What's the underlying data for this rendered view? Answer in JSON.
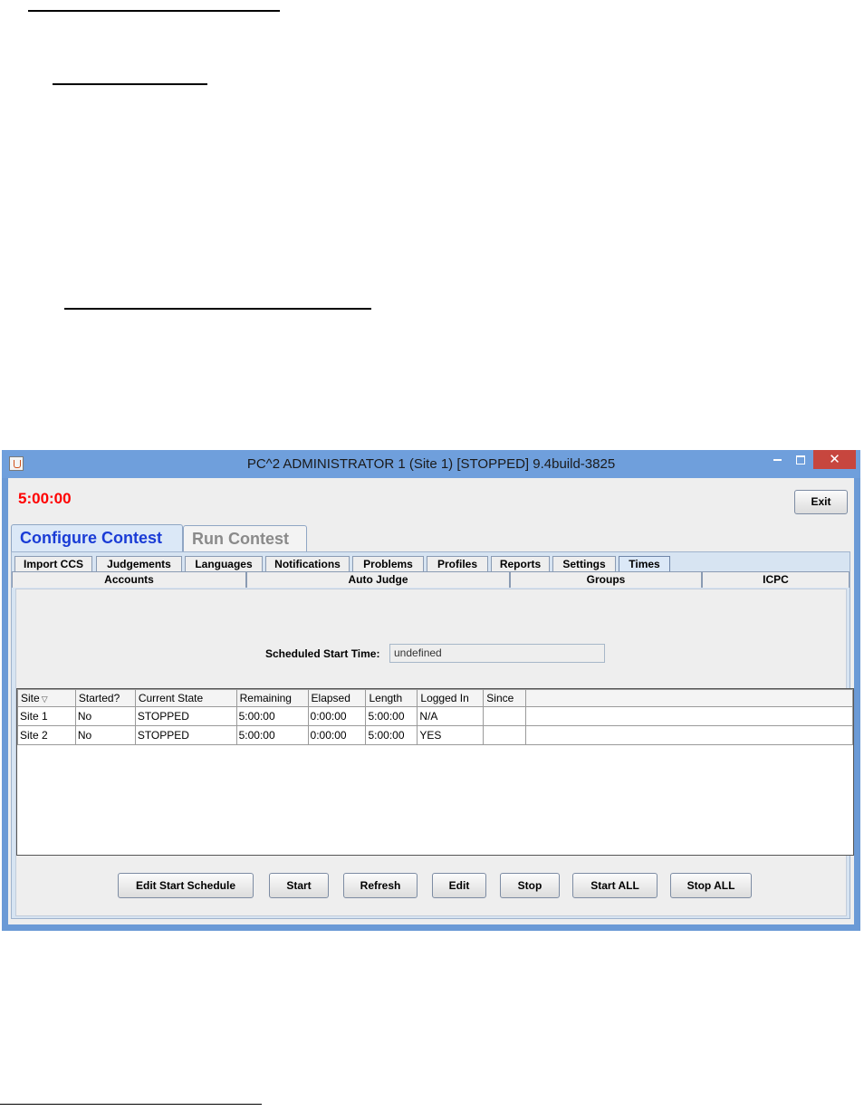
{
  "window": {
    "title": "PC^2 ADMINISTRATOR 1 (Site 1) [STOPPED] 9.4build-3825",
    "close_glyph": "✕"
  },
  "header": {
    "timer": "5:00:00",
    "exit_label": "Exit"
  },
  "main_tabs": [
    {
      "label": "Configure Contest",
      "active": true
    },
    {
      "label": "Run Contest",
      "active": false
    }
  ],
  "sub_tabs_row1": [
    {
      "label": "Import CCS"
    },
    {
      "label": "Judgements"
    },
    {
      "label": "Languages"
    },
    {
      "label": "Notifications"
    },
    {
      "label": "Problems"
    },
    {
      "label": "Profiles"
    },
    {
      "label": "Reports"
    },
    {
      "label": "Settings"
    },
    {
      "label": "Times",
      "active": true
    }
  ],
  "sub_tabs_row2": [
    {
      "label": "Accounts"
    },
    {
      "label": "Auto Judge"
    },
    {
      "label": "Groups"
    },
    {
      "label": "ICPC"
    }
  ],
  "schedule": {
    "label": "Scheduled Start Time:",
    "value": "undefined"
  },
  "table": {
    "columns": [
      "Site",
      "Started?",
      "Current State",
      "Remaining",
      "Elapsed",
      "Length",
      "Logged In",
      "Since",
      ""
    ],
    "rows": [
      [
        "Site 1",
        "No",
        "STOPPED",
        "5:00:00",
        "0:00:00",
        "5:00:00",
        "N/A",
        "",
        ""
      ],
      [
        "Site 2",
        "No",
        "STOPPED",
        "5:00:00",
        "0:00:00",
        "5:00:00",
        "YES",
        "",
        ""
      ]
    ]
  },
  "buttons": {
    "edit_schedule": "Edit Start Schedule",
    "start": "Start",
    "refresh": "Refresh",
    "edit": "Edit",
    "stop": "Stop",
    "start_all": "Start ALL",
    "stop_all": "Stop ALL"
  },
  "colors": {
    "timer": "#ff0000",
    "active_tab_text": "#1a3cd6",
    "titlebar": "#6f9fdc",
    "close_button": "#c7463e"
  }
}
